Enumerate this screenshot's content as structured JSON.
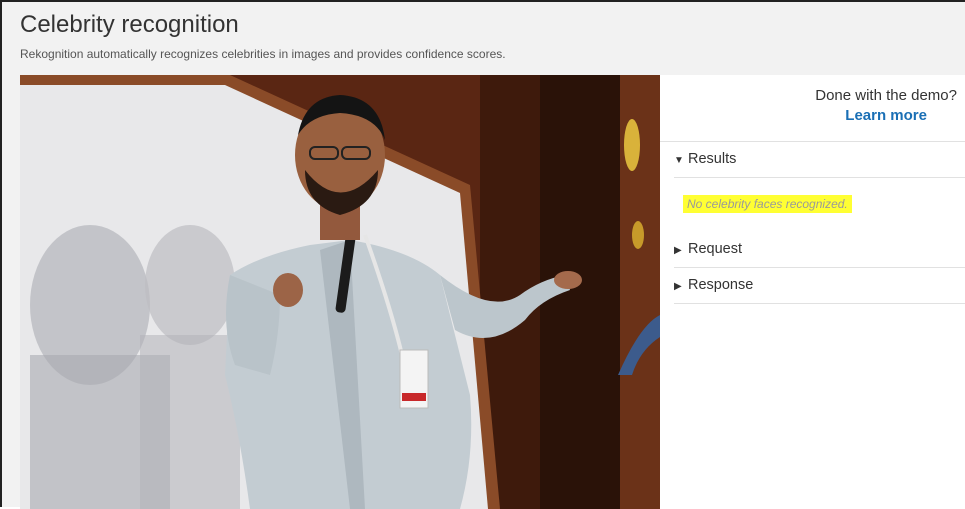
{
  "header": {
    "title": "Celebrity recognition",
    "subtitle": "Rekognition automatically recognizes celebrities in images and provides confidence scores."
  },
  "panel": {
    "done_text": "Done with the demo?",
    "learn_more": "Learn more",
    "sections": {
      "results": "Results",
      "request": "Request",
      "response": "Response"
    },
    "results_message": "No celebrity faces recognized.",
    "highlight_color": "#ffff33",
    "link_color": "#1a6fb5"
  },
  "photo": {
    "subject": "speaker-with-microphone-image"
  }
}
